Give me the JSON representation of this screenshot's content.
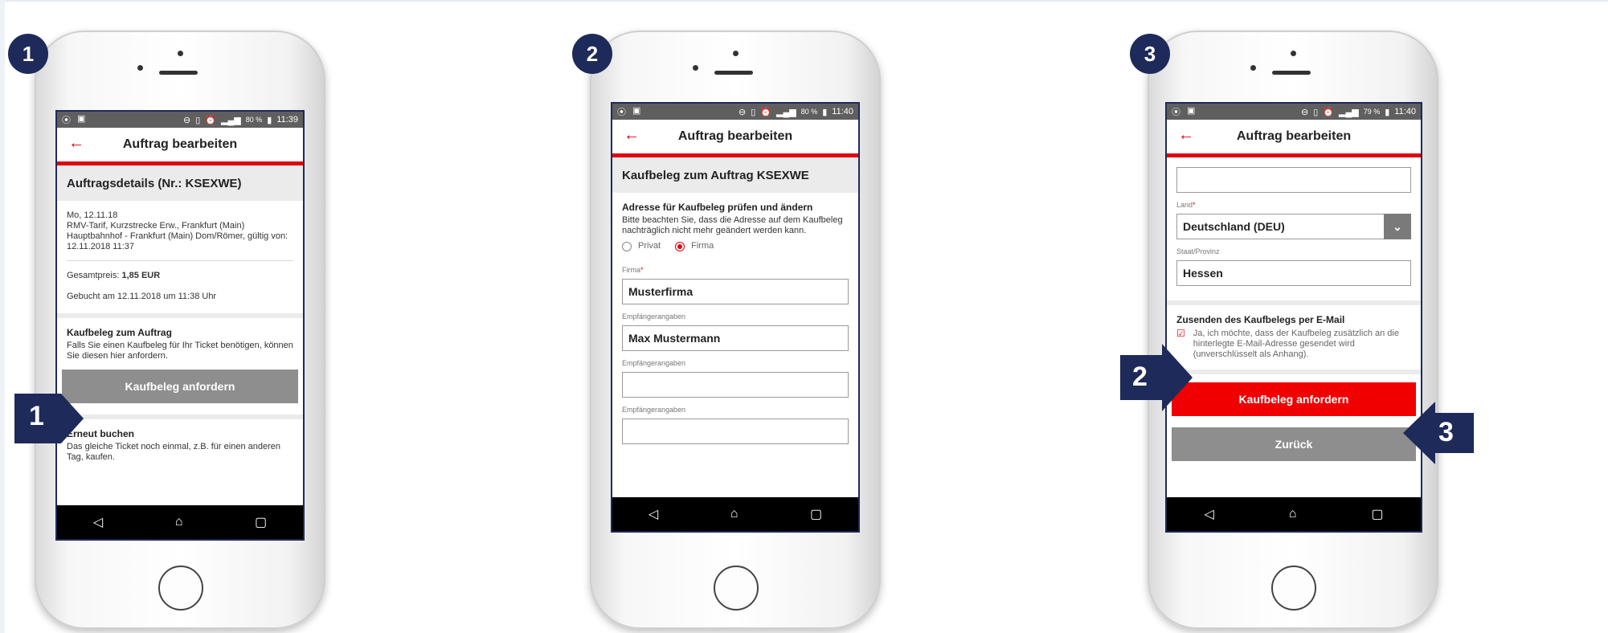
{
  "steps": [
    {
      "badge": "1"
    },
    {
      "badge": "2"
    },
    {
      "badge": "3"
    }
  ],
  "markers": {
    "m1": "1",
    "m2": "2",
    "m3": "3"
  },
  "phone1": {
    "status_time": "11:39",
    "status_battery": "80 %",
    "title": "Auftrag bearbeiten",
    "section_title": "Auftragsdetails (Nr.: KSEXWE)",
    "date": "Mo, 12.11.18",
    "description": "RMV-Tarif, Kurzstrecke Erw., Frankfurt (Main) Hauptbahnhof - Frankfurt (Main) Dom/Römer, gültig von: 12.11.2018 11:37",
    "total_label": "Gesamtpreis:",
    "total_value": "1,85 EUR",
    "booked": "Gebucht am 12.11.2018 um 11:38 Uhr",
    "receipt_heading": "Kaufbeleg zum Auftrag",
    "receipt_text": "Falls Sie einen Kaufbeleg für Ihr Ticket benötigen, können Sie diesen hier anfordern.",
    "receipt_button": "Kaufbeleg anfordern",
    "rebook_heading": "Erneut buchen",
    "rebook_text": "Das gleiche Ticket noch einmal, z.B. für einen anderen Tag, kaufen."
  },
  "phone2": {
    "status_time": "11:40",
    "status_battery": "80 %",
    "title": "Auftrag bearbeiten",
    "section_title": "Kaufbeleg zum Auftrag KSEXWE",
    "address_heading": "Adresse für Kaufbeleg prüfen und ändern",
    "address_text": "Bitte beachten Sie, dass die Adresse auf dem Kaufbeleg nachträglich nicht mehr geändert werden kann.",
    "radio_private": "Privat",
    "radio_company": "Firma",
    "company_label": "Firma",
    "required_mark": "*",
    "company_value": "Musterfirma",
    "recipient_label_1": "Empfängerangaben",
    "recipient_value_1": "Max Mustermann",
    "recipient_label_2": "Empfängerangaben",
    "recipient_value_2": "",
    "recipient_label_3": "Empfängerangaben",
    "recipient_value_3": ""
  },
  "phone3": {
    "status_time": "11:40",
    "status_battery": "79 %",
    "title": "Auftrag bearbeiten",
    "field_top_value": "",
    "country_label": "Land",
    "required_mark": "*",
    "country_value": "Deutschland (DEU)",
    "state_label": "Staat/Provinz",
    "state_value": "Hessen",
    "email_heading": "Zusenden des Kaufbelegs per E-Mail",
    "email_text": "Ja, ich möchte, dass der Kaufbeleg zusätzlich an die hinterlegte E-Mail-Adresse gesendet wird (unverschlüsselt als Anhang).",
    "request_button": "Kaufbeleg anfordern",
    "back_button": "Zurück"
  },
  "colors": {
    "accent_red": "#e3000f",
    "navy": "#1e2a5a",
    "grey_button": "#8e8e8e"
  },
  "icons": [
    "back-arrow-icon",
    "nav-back-icon",
    "nav-home-icon",
    "nav-recents-icon",
    "chevron-down-icon",
    "checkbox-icon"
  ]
}
